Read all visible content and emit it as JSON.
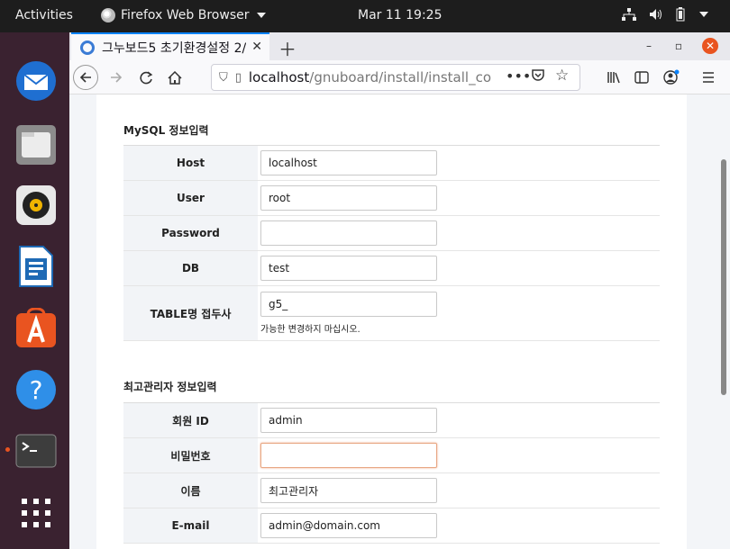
{
  "topbar": {
    "activities": "Activities",
    "app_name": "Firefox Web Browser",
    "clock": "Mar 11  19:25"
  },
  "browser": {
    "tab_title": "그누보드5 초기환경설정 2/",
    "url_host": "localhost",
    "url_path": "/gnuboard/install/install_co"
  },
  "mysql": {
    "section_title": "MySQL 정보입력",
    "rows": [
      {
        "label": "Host",
        "value": "localhost"
      },
      {
        "label": "User",
        "value": "root"
      },
      {
        "label": "Password",
        "value": ""
      },
      {
        "label": "DB",
        "value": "test"
      },
      {
        "label": "TABLE명 접두사",
        "value": "g5_",
        "help": "가능한 변경하지 마십시오."
      }
    ]
  },
  "admin": {
    "section_title": "최고관리자 정보입력",
    "rows": [
      {
        "label": "회원 ID",
        "value": "admin"
      },
      {
        "label": "비밀번호",
        "value": ""
      },
      {
        "label": "이름",
        "value": "최고관리자"
      },
      {
        "label": "E-mail",
        "value": "admin@domain.com"
      }
    ]
  },
  "colors": {
    "accent": "#e95420",
    "tab_highlight": "#0a84ff",
    "table_header_bg": "#f2f4f7"
  }
}
